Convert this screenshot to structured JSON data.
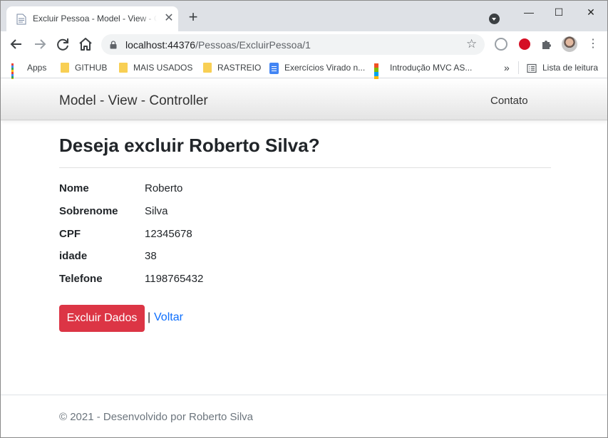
{
  "browser": {
    "tab_title": "Excluir Pessoa - Model - View - Controller",
    "tab_close_glyph": "✕",
    "new_tab_glyph": "+",
    "url_host": "localhost:44376",
    "url_path": "/Pessoas/ExcluirPessoa/1",
    "window_controls": {
      "minimize": "—",
      "maximize": "☐",
      "close": "✕"
    },
    "bookmarks": [
      {
        "label": "Apps",
        "icon": "apps-grid-icon"
      },
      {
        "label": "GITHUB",
        "icon": "folder-icon"
      },
      {
        "label": "MAIS USADOS",
        "icon": "folder-icon"
      },
      {
        "label": "RASTREIO",
        "icon": "folder-icon"
      },
      {
        "label": "Exercícios Virado n...",
        "icon": "google-docs-icon"
      },
      {
        "label": "Introdução MVC AS...",
        "icon": "microsoft-icon"
      }
    ],
    "bookmarks_overflow": "»",
    "reading_list": "Lista de leitura"
  },
  "navbar": {
    "brand": "Model - View - Controller",
    "link_contact": "Contato"
  },
  "page": {
    "heading": "Deseja excluir Roberto Silva?",
    "fields": [
      {
        "label": "Nome",
        "value": "Roberto"
      },
      {
        "label": "Sobrenome",
        "value": "Silva"
      },
      {
        "label": "CPF",
        "value": "12345678"
      },
      {
        "label": "idade",
        "value": "38"
      },
      {
        "label": "Telefone",
        "value": "1198765432"
      }
    ],
    "delete_button": "Excluir Dados",
    "separator": "|",
    "back_link": "Voltar"
  },
  "footer": {
    "text": "© 2021 - Desenvolvido por Roberto Silva"
  },
  "colors": {
    "danger": "#dc3545",
    "link": "#0d6efd",
    "chrome_tabstrip": "#dee1e6"
  }
}
